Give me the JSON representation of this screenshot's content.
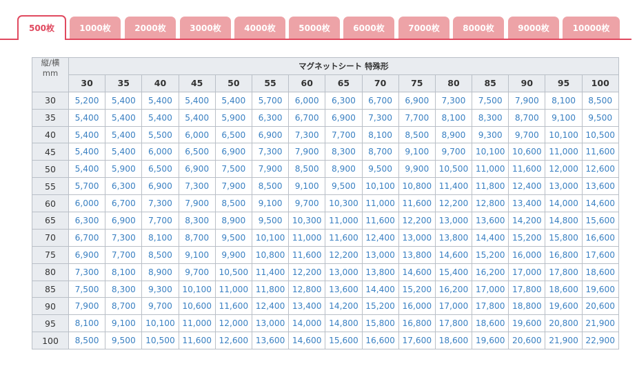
{
  "tabs": [
    {
      "label": "500枚",
      "active": true
    },
    {
      "label": "1000枚",
      "active": false
    },
    {
      "label": "2000枚",
      "active": false
    },
    {
      "label": "3000枚",
      "active": false
    },
    {
      "label": "4000枚",
      "active": false
    },
    {
      "label": "5000枚",
      "active": false
    },
    {
      "label": "6000枚",
      "active": false
    },
    {
      "label": "7000枚",
      "active": false
    },
    {
      "label": "8000枚",
      "active": false
    },
    {
      "label": "9000枚",
      "active": false
    },
    {
      "label": "10000枚",
      "active": false
    }
  ],
  "table": {
    "corner_line1": "縦/横",
    "corner_line2": "mm",
    "group_title": "マグネットシート 特殊形",
    "columns": [
      "30",
      "35",
      "40",
      "45",
      "50",
      "55",
      "60",
      "65",
      "70",
      "75",
      "80",
      "85",
      "90",
      "95",
      "100"
    ],
    "rows": [
      {
        "label": "30",
        "cells": [
          "5,200",
          "5,400",
          "5,400",
          "5,400",
          "5,400",
          "5,700",
          "6,000",
          "6,300",
          "6,700",
          "6,900",
          "7,300",
          "7,500",
          "7,900",
          "8,100",
          "8,500"
        ]
      },
      {
        "label": "35",
        "cells": [
          "5,400",
          "5,400",
          "5,400",
          "5,400",
          "5,900",
          "6,300",
          "6,700",
          "6,900",
          "7,300",
          "7,700",
          "8,100",
          "8,300",
          "8,700",
          "9,100",
          "9,500"
        ]
      },
      {
        "label": "40",
        "cells": [
          "5,400",
          "5,400",
          "5,500",
          "6,000",
          "6,500",
          "6,900",
          "7,300",
          "7,700",
          "8,100",
          "8,500",
          "8,900",
          "9,300",
          "9,700",
          "10,100",
          "10,500"
        ]
      },
      {
        "label": "45",
        "cells": [
          "5,400",
          "5,400",
          "6,000",
          "6,500",
          "6,900",
          "7,300",
          "7,900",
          "8,300",
          "8,700",
          "9,100",
          "9,700",
          "10,100",
          "10,600",
          "11,000",
          "11,600"
        ]
      },
      {
        "label": "50",
        "cells": [
          "5,400",
          "5,900",
          "6,500",
          "6,900",
          "7,500",
          "7,900",
          "8,500",
          "8,900",
          "9,500",
          "9,900",
          "10,500",
          "11,000",
          "11,600",
          "12,000",
          "12,600"
        ]
      },
      {
        "label": "55",
        "cells": [
          "5,700",
          "6,300",
          "6,900",
          "7,300",
          "7,900",
          "8,500",
          "9,100",
          "9,500",
          "10,100",
          "10,800",
          "11,400",
          "11,800",
          "12,400",
          "13,000",
          "13,600"
        ]
      },
      {
        "label": "60",
        "cells": [
          "6,000",
          "6,700",
          "7,300",
          "7,900",
          "8,500",
          "9,100",
          "9,700",
          "10,300",
          "11,000",
          "11,600",
          "12,200",
          "12,800",
          "13,400",
          "14,000",
          "14,600"
        ]
      },
      {
        "label": "65",
        "cells": [
          "6,300",
          "6,900",
          "7,700",
          "8,300",
          "8,900",
          "9,500",
          "10,300",
          "11,000",
          "11,600",
          "12,200",
          "13,000",
          "13,600",
          "14,200",
          "14,800",
          "15,600"
        ]
      },
      {
        "label": "70",
        "cells": [
          "6,700",
          "7,300",
          "8,100",
          "8,700",
          "9,500",
          "10,100",
          "11,000",
          "11,600",
          "12,400",
          "13,000",
          "13,800",
          "14,400",
          "15,200",
          "15,800",
          "16,600"
        ]
      },
      {
        "label": "75",
        "cells": [
          "6,900",
          "7,700",
          "8,500",
          "9,100",
          "9,900",
          "10,800",
          "11,600",
          "12,200",
          "13,000",
          "13,800",
          "14,600",
          "15,200",
          "16,000",
          "16,800",
          "17,600"
        ]
      },
      {
        "label": "80",
        "cells": [
          "7,300",
          "8,100",
          "8,900",
          "9,700",
          "10,500",
          "11,400",
          "12,200",
          "13,000",
          "13,800",
          "14,600",
          "15,400",
          "16,200",
          "17,000",
          "17,800",
          "18,600"
        ]
      },
      {
        "label": "85",
        "cells": [
          "7,500",
          "8,300",
          "9,300",
          "10,100",
          "11,000",
          "11,800",
          "12,800",
          "13,600",
          "14,400",
          "15,200",
          "16,200",
          "17,000",
          "17,800",
          "18,600",
          "19,600"
        ]
      },
      {
        "label": "90",
        "cells": [
          "7,900",
          "8,700",
          "9,700",
          "10,600",
          "11,600",
          "12,400",
          "13,400",
          "14,200",
          "15,200",
          "16,000",
          "17,000",
          "17,800",
          "18,800",
          "19,600",
          "20,600"
        ]
      },
      {
        "label": "95",
        "cells": [
          "8,100",
          "9,100",
          "10,100",
          "11,000",
          "12,000",
          "13,000",
          "14,000",
          "14,800",
          "15,800",
          "16,800",
          "17,800",
          "18,600",
          "19,600",
          "20,800",
          "21,900"
        ]
      },
      {
        "label": "100",
        "cells": [
          "8,500",
          "9,500",
          "10,500",
          "11,600",
          "12,600",
          "13,600",
          "14,600",
          "15,600",
          "16,600",
          "17,600",
          "18,600",
          "19,600",
          "20,600",
          "21,900",
          "22,900"
        ]
      }
    ]
  },
  "colors": {
    "accent": "#e0495f",
    "tab_inactive": "#eda3a7",
    "header_bg": "#e9ecf0",
    "price_text": "#3a80c2",
    "grid_border": "#b9bfc7"
  }
}
